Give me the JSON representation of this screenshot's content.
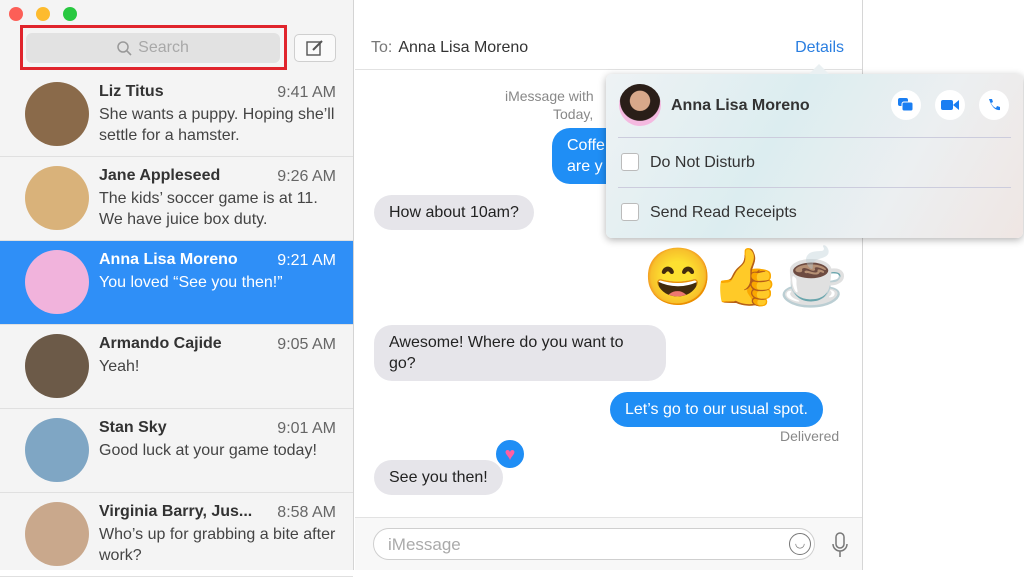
{
  "sidebar": {
    "search_placeholder": "Search",
    "conversations": [
      {
        "name": "Liz Titus",
        "time": "9:41 AM",
        "preview": "She wants a puppy. Hoping she’ll settle for a hamster.",
        "avatar_color": "#8a6a4a"
      },
      {
        "name": "Jane Appleseed",
        "time": "9:26 AM",
        "preview": "The kids’ soccer game is at 11. We have juice box duty.",
        "avatar_color": "#d9b27a"
      },
      {
        "name": "Anna Lisa Moreno",
        "time": "9:21 AM",
        "preview": "You loved “See you then!”",
        "avatar_color": "#f1b3dc",
        "selected": true
      },
      {
        "name": "Armando Cajide",
        "time": "9:05 AM",
        "preview": "Yeah!",
        "avatar_color": "#6c5a48"
      },
      {
        "name": "Stan Sky",
        "time": "9:01 AM",
        "preview": "Good luck at your game today!",
        "avatar_color": "#7fa6c4"
      },
      {
        "name": "Virginia Barry, Jus...",
        "time": "8:58 AM",
        "preview": "Who’s up for grabbing a bite after work?",
        "avatar_color": "#c9a88c"
      }
    ]
  },
  "header": {
    "to_label": "To:",
    "recipient": "Anna Lisa Moreno",
    "details": "Details"
  },
  "thread": {
    "meta1": "iMessage with",
    "meta2": "Today,",
    "m1": "Coffe\nare y",
    "m2": "How about 10am?",
    "emoji": "😄👍☕",
    "m3": "Awesome! Where do you want to go?",
    "m4": "Let’s go to our usual spot.",
    "delivered": "Delivered",
    "m5": "See you then!",
    "tapback": "heart"
  },
  "input": {
    "placeholder": "iMessage"
  },
  "popover": {
    "name": "Anna Lisa Moreno",
    "dnd": "Do Not Disturb",
    "receipts": "Send Read Receipts",
    "dnd_checked": false,
    "receipts_checked": false
  },
  "colors": {
    "accent": "#2f8ff7",
    "highlight": "#e0242c"
  }
}
